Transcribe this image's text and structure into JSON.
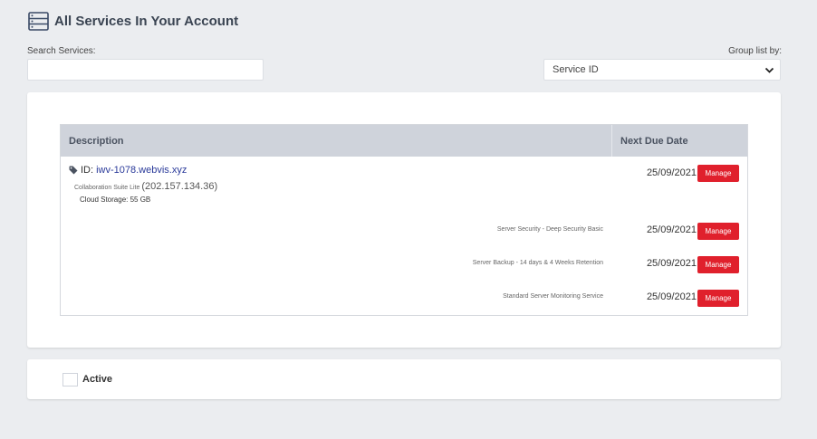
{
  "header": {
    "icon": "server-list-icon",
    "title": "All Services In Your Account"
  },
  "search": {
    "label": "Search Services:",
    "value": "",
    "placeholder": ""
  },
  "group": {
    "label": "Group list by:",
    "selected": "Service ID"
  },
  "table": {
    "columns": [
      "Description",
      "Next Due Date"
    ],
    "main_service": {
      "id_prefix": "ID:",
      "id_value": "iwv-1078.webvis.xyz",
      "plan": "Collaboration Suite Lite",
      "ip": "(202.157.134.36)",
      "storage": "Cloud Storage: 55 GB",
      "due_date": "25/09/2021",
      "action": "Manage"
    },
    "addons": [
      {
        "name": "Server Security - Deep Security Basic",
        "due_date": "25/09/2021",
        "action": "Manage"
      },
      {
        "name": "Server Backup - 14 days & 4 Weeks Retention",
        "due_date": "25/09/2021",
        "action": "Manage"
      },
      {
        "name": "Standard Server Monitoring Service",
        "due_date": "25/09/2021",
        "action": "Manage"
      }
    ]
  },
  "filter": {
    "label": "Active",
    "checked": false
  },
  "colors": {
    "background": "#ebedf0",
    "table_header": "#cfd3db",
    "manage_button": "#e0202c",
    "link": "#2a3a9a"
  }
}
